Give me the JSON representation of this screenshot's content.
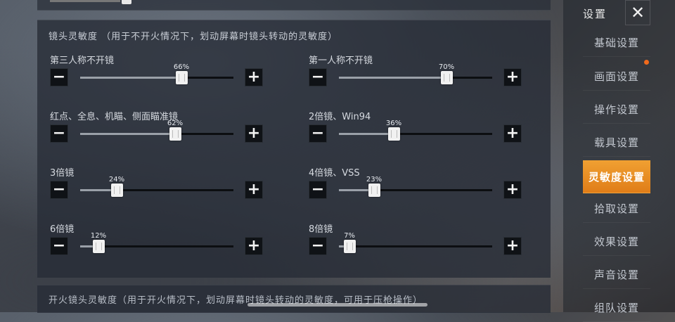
{
  "panel": {
    "title": "镜头灵敏度 （用于不开火情况下，划动屏幕时镜头转动的灵敏度）",
    "sliders": [
      {
        "label": "第三人称不开镜",
        "value": 66,
        "text": "66%"
      },
      {
        "label": "第一人称不开镜",
        "value": 70,
        "text": "70%"
      },
      {
        "label": "红点、全息、机瞄、侧面瞄准镜",
        "value": 62,
        "text": "62%"
      },
      {
        "label": "2倍镜、Win94",
        "value": 36,
        "text": "36%"
      },
      {
        "label": "3倍镜",
        "value": 24,
        "text": "24%"
      },
      {
        "label": "4倍镜、VSS",
        "value": 23,
        "text": "23%"
      },
      {
        "label": "6倍镜",
        "value": 12,
        "text": "12%"
      },
      {
        "label": "8倍镜",
        "value": 7,
        "text": "7%"
      }
    ],
    "minus_symbol": "−",
    "plus_symbol": "+"
  },
  "bottom_panel": {
    "title": "开火镜头灵敏度（用于开火情况下，划动屏幕时镜头转动的灵敏度，可用于压枪操作）"
  },
  "sidebar": {
    "title": "设置",
    "close_symbol": "✕",
    "items": [
      {
        "label": "基础设置"
      },
      {
        "label": "画面设置"
      },
      {
        "label": "操作设置"
      },
      {
        "label": "载具设置"
      },
      {
        "label": "灵敏度设置",
        "active": true
      },
      {
        "label": "拾取设置"
      },
      {
        "label": "效果设置"
      },
      {
        "label": "声音设置"
      },
      {
        "label": "组队设置"
      }
    ]
  },
  "colors": {
    "accent": "#e8891f",
    "notification_dot": "#f06a1c"
  }
}
